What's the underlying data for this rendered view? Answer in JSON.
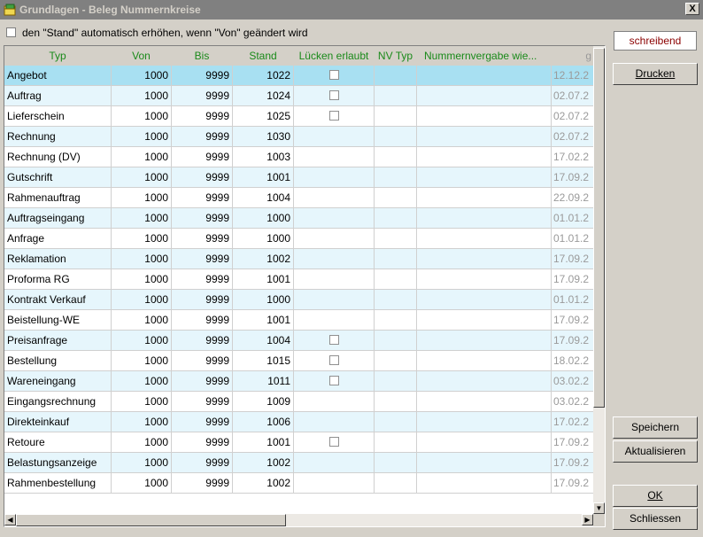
{
  "window": {
    "title": "Grundlagen - Beleg Nummernkreise",
    "close": "X"
  },
  "option": {
    "label": "den \"Stand\" automatisch erhöhen, wenn \"Von\" geändert wird",
    "checked": false
  },
  "columns": {
    "typ": "Typ",
    "von": "Von",
    "bis": "Bis",
    "stand": "Stand",
    "luecken": "Lücken erlaubt",
    "nvtyp": "NV Typ",
    "nummernvergabe": "Nummernvergabe wie...",
    "geaendert": "g"
  },
  "rows": [
    {
      "typ": "Angebot",
      "von": "1000",
      "bis": "9999",
      "stand": "1022",
      "luecken": true,
      "nv": "",
      "numv": "",
      "date": "12.12.2"
    },
    {
      "typ": "Auftrag",
      "von": "1000",
      "bis": "9999",
      "stand": "1024",
      "luecken": true,
      "nv": "",
      "numv": "",
      "date": "02.07.2"
    },
    {
      "typ": "Lieferschein",
      "von": "1000",
      "bis": "9999",
      "stand": "1025",
      "luecken": true,
      "nv": "",
      "numv": "",
      "date": "02.07.2"
    },
    {
      "typ": "Rechnung",
      "von": "1000",
      "bis": "9999",
      "stand": "1030",
      "luecken": false,
      "nv": "",
      "numv": "",
      "date": "02.07.2"
    },
    {
      "typ": "Rechnung (DV)",
      "von": "1000",
      "bis": "9999",
      "stand": "1003",
      "luecken": false,
      "nv": "",
      "numv": "",
      "date": "17.02.2"
    },
    {
      "typ": "Gutschrift",
      "von": "1000",
      "bis": "9999",
      "stand": "1001",
      "luecken": false,
      "nv": "",
      "numv": "",
      "date": "17.09.2"
    },
    {
      "typ": "Rahmenauftrag",
      "von": "1000",
      "bis": "9999",
      "stand": "1004",
      "luecken": false,
      "nv": "",
      "numv": "",
      "date": "22.09.2"
    },
    {
      "typ": "Auftragseingang",
      "von": "1000",
      "bis": "9999",
      "stand": "1000",
      "luecken": false,
      "nv": "",
      "numv": "",
      "date": "01.01.2"
    },
    {
      "typ": "Anfrage",
      "von": "1000",
      "bis": "9999",
      "stand": "1000",
      "luecken": false,
      "nv": "",
      "numv": "",
      "date": "01.01.2"
    },
    {
      "typ": "Reklamation",
      "von": "1000",
      "bis": "9999",
      "stand": "1002",
      "luecken": false,
      "nv": "",
      "numv": "",
      "date": "17.09.2"
    },
    {
      "typ": "Proforma RG",
      "von": "1000",
      "bis": "9999",
      "stand": "1001",
      "luecken": false,
      "nv": "",
      "numv": "",
      "date": "17.09.2"
    },
    {
      "typ": "Kontrakt Verkauf",
      "von": "1000",
      "bis": "9999",
      "stand": "1000",
      "luecken": false,
      "nv": "",
      "numv": "",
      "date": "01.01.2"
    },
    {
      "typ": "Beistellung-WE",
      "von": "1000",
      "bis": "9999",
      "stand": "1001",
      "luecken": false,
      "nv": "",
      "numv": "",
      "date": "17.09.2"
    },
    {
      "typ": "Preisanfrage",
      "von": "1000",
      "bis": "9999",
      "stand": "1004",
      "luecken": true,
      "nv": "",
      "numv": "",
      "date": "17.09.2"
    },
    {
      "typ": "Bestellung",
      "von": "1000",
      "bis": "9999",
      "stand": "1015",
      "luecken": true,
      "nv": "",
      "numv": "",
      "date": "18.02.2"
    },
    {
      "typ": "Wareneingang",
      "von": "1000",
      "bis": "9999",
      "stand": "1011",
      "luecken": true,
      "nv": "",
      "numv": "",
      "date": "03.02.2"
    },
    {
      "typ": "Eingangsrechnung",
      "von": "1000",
      "bis": "9999",
      "stand": "1009",
      "luecken": false,
      "nv": "",
      "numv": "",
      "date": "03.02.2"
    },
    {
      "typ": "Direkteinkauf",
      "von": "1000",
      "bis": "9999",
      "stand": "1006",
      "luecken": false,
      "nv": "",
      "numv": "",
      "date": "17.02.2"
    },
    {
      "typ": "Retoure",
      "von": "1000",
      "bis": "9999",
      "stand": "1001",
      "luecken": true,
      "nv": "",
      "numv": "",
      "date": "17.09.2"
    },
    {
      "typ": "Belastungsanzeige",
      "von": "1000",
      "bis": "9999",
      "stand": "1002",
      "luecken": false,
      "nv": "",
      "numv": "",
      "date": "17.09.2"
    },
    {
      "typ": "Rahmenbestellung",
      "von": "1000",
      "bis": "9999",
      "stand": "1002",
      "luecken": false,
      "nv": "",
      "numv": "",
      "date": "17.09.2"
    }
  ],
  "selected_index": 0,
  "status": {
    "text": "schreibend",
    "color": "#8b0000"
  },
  "buttons": {
    "drucken": "Drucken",
    "speichern": "Speichern",
    "aktualisieren": "Aktualisieren",
    "ok": "OK",
    "schliessen": "Schliessen"
  },
  "icons": {
    "app": "folder-icon",
    "scroll_up": "arrow-up-icon",
    "scroll_down": "arrow-down-icon",
    "scroll_left": "arrow-left-icon",
    "scroll_right": "arrow-right-icon"
  }
}
